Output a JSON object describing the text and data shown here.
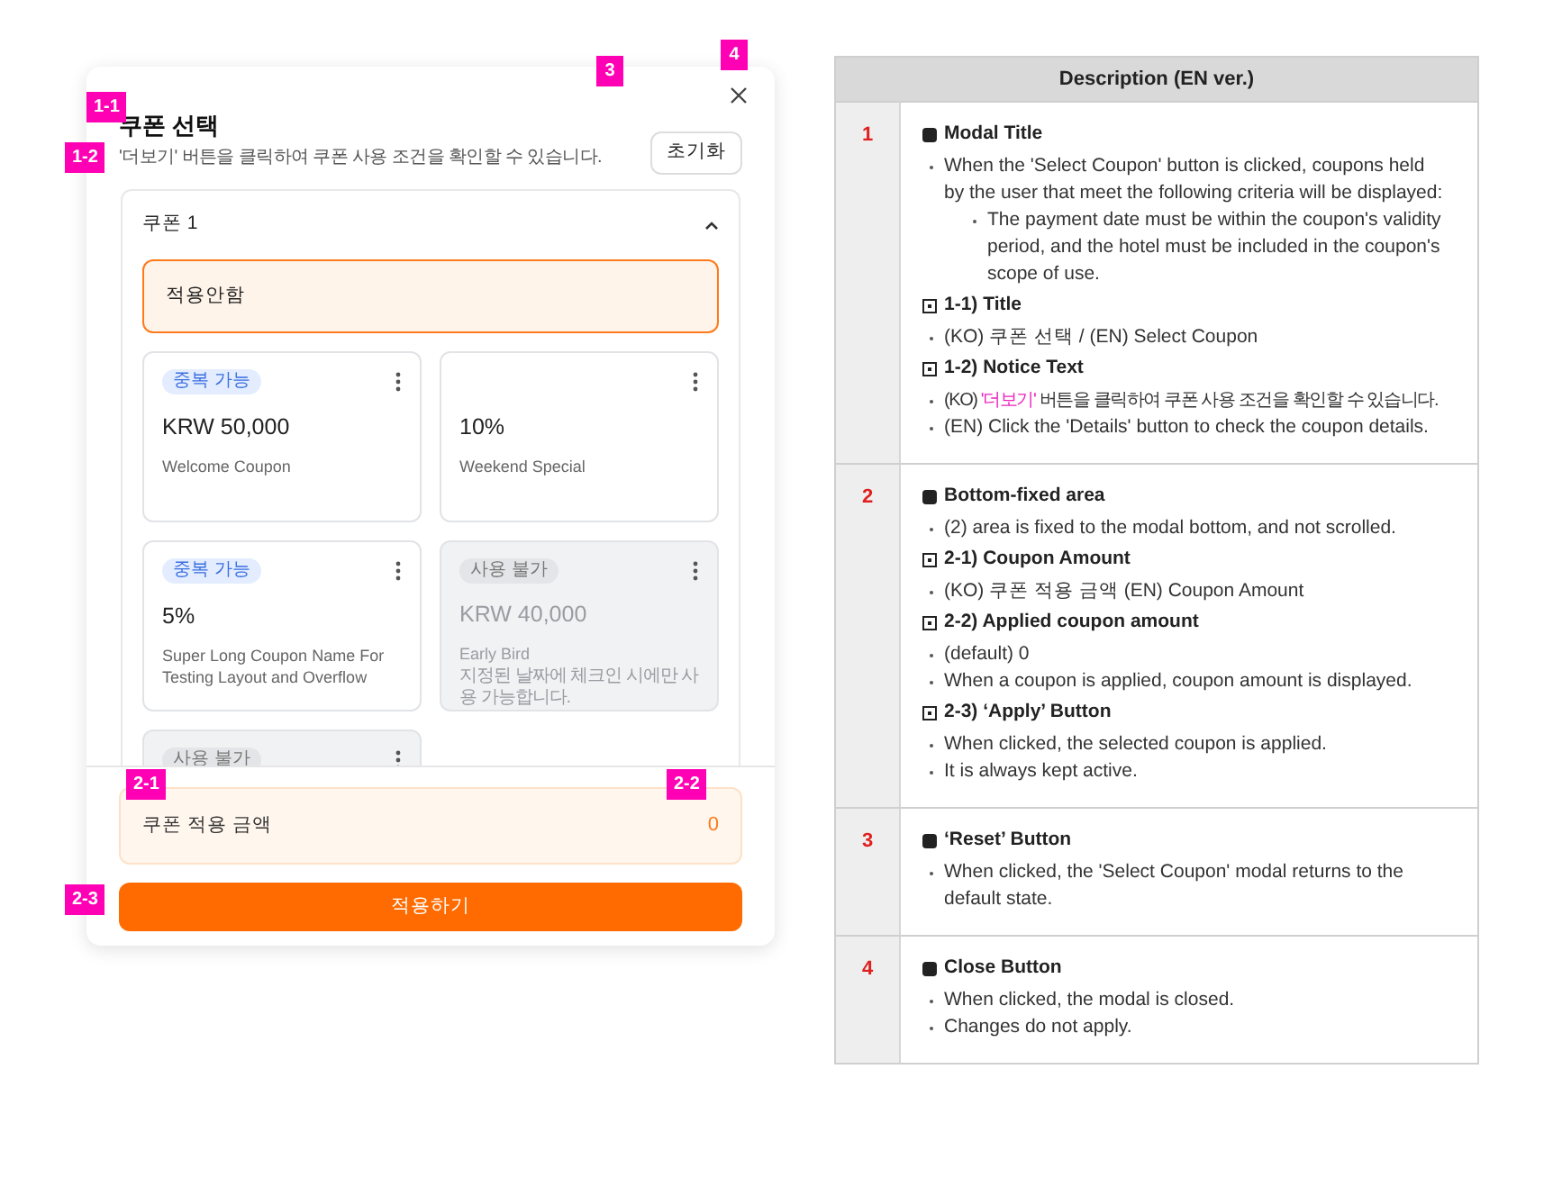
{
  "modal": {
    "title": "쿠폰 선택",
    "notice": "'더보기' 버튼을 클릭하여 쿠폰 사용 조건을 확인할 수 있습니다.",
    "reset_button": "초기화",
    "coupon_group": {
      "title": "쿠폰 1",
      "expanded": true,
      "options": [
        {
          "label": "적용안함",
          "selected": true
        }
      ],
      "coupons": [
        {
          "badge": {
            "text": "중복 가능",
            "kind": "stackable"
          },
          "amount": "KRW 50,000",
          "name": "Welcome Coupon",
          "disabled": false
        },
        {
          "amount": "10%",
          "name": "Weekend Special",
          "disabled": false
        },
        {
          "badge": {
            "text": "중복 가능",
            "kind": "stackable"
          },
          "amount": "5%",
          "name": "Super Long Coupon Name For Testing Layout and Overflow",
          "disabled": false
        },
        {
          "badge": {
            "text": "사용 불가",
            "kind": "unavailable"
          },
          "amount": "KRW 40,000",
          "name": "Early Bird",
          "note": "지정된 날짜에 체크인 시에만 사용 가능합니다.",
          "disabled": true
        },
        {
          "badge": {
            "text": "사용 불가",
            "kind": "unavailable"
          },
          "disabled": true
        }
      ]
    },
    "amount": {
      "label": "쿠폰 적용 금액",
      "value": "0"
    },
    "apply_button": "적용하기"
  },
  "markers": [
    {
      "label": "1-1"
    },
    {
      "label": "1-2"
    },
    {
      "label": "3"
    },
    {
      "label": "4"
    },
    {
      "label": "2-1"
    },
    {
      "label": "2-2"
    },
    {
      "label": "2-3"
    }
  ],
  "description": {
    "title": "Description (EN ver.)",
    "rows": [
      {
        "number": "1",
        "sections": [
          {
            "kind": "main",
            "heading": "Modal Title",
            "bullets": [
              {
                "text": "When the 'Select Coupon' button is clicked, coupons held by the user that meet the following criteria will be displayed:",
                "children": [
                  {
                    "text": "The payment date must be within the coupon's validity period, and the hotel must be included in the coupon's scope of use."
                  }
                ]
              }
            ]
          },
          {
            "kind": "sub",
            "heading": "1-1) Title",
            "bullets": [
              {
                "text": "(KO) 쿠폰 선택 / (EN) Select Coupon"
              }
            ]
          },
          {
            "kind": "sub",
            "heading": "1-2) Notice Text",
            "bullets": [
              {
                "parts": [
                  {
                    "text": "(KO) ",
                    "highlight": false
                  },
                  {
                    "text": "'더보기'",
                    "highlight": true
                  },
                  {
                    "text": " 버튼을 클릭하여 쿠폰 사용 조건을 확인할 수 있습니다.",
                    "highlight": false
                  }
                ]
              },
              {
                "text": "(EN) Click the 'Details' button to check the coupon details."
              }
            ]
          }
        ]
      },
      {
        "number": "2",
        "sections": [
          {
            "kind": "main",
            "heading": "Bottom-fixed area",
            "bullets": [
              {
                "text": "(2) area is fixed to the modal bottom, and not scrolled."
              }
            ]
          },
          {
            "kind": "sub",
            "heading": "2-1) Coupon Amount",
            "bullets": [
              {
                "text": "(KO) 쿠폰 적용 금액 (EN) Coupon Amount"
              }
            ]
          },
          {
            "kind": "sub",
            "heading": "2-2) Applied coupon amount",
            "bullets": [
              {
                "text": "(default) 0"
              },
              {
                "text": "When a coupon is applied, coupon amount is displayed."
              }
            ]
          },
          {
            "kind": "sub",
            "heading": "2-3) ‘Apply’ Button",
            "bullets": [
              {
                "text": "When clicked, the selected coupon is applied."
              },
              {
                "text": "It is always kept active."
              }
            ]
          }
        ]
      },
      {
        "number": "3",
        "sections": [
          {
            "kind": "main",
            "heading": "‘Reset’ Button",
            "bullets": [
              {
                "text": "When clicked, the 'Select Coupon' modal returns to the default state."
              }
            ]
          }
        ]
      },
      {
        "number": "4",
        "sections": [
          {
            "kind": "main",
            "heading": "Close Button",
            "bullets": [
              {
                "text": "When clicked, the modal is closed."
              },
              {
                "text": "Changes do not apply."
              }
            ]
          }
        ]
      }
    ]
  }
}
